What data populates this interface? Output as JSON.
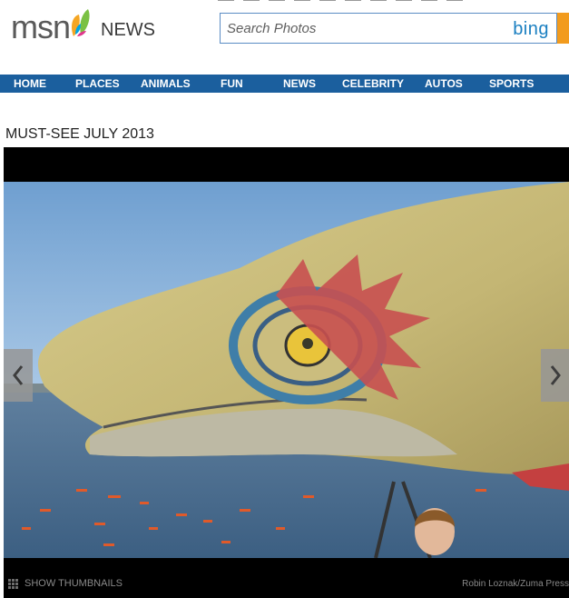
{
  "header": {
    "logo_text": "msn",
    "section_label": "NEWS",
    "search": {
      "placeholder": "Search Photos",
      "engine": "bing"
    }
  },
  "nav": {
    "items": [
      {
        "label": "HOME"
      },
      {
        "label": "PLACES"
      },
      {
        "label": "ANIMALS"
      },
      {
        "label": "FUN"
      },
      {
        "label": "NEWS"
      },
      {
        "label": "CELEBRITY"
      },
      {
        "label": "AUTOS"
      },
      {
        "label": "SPORTS"
      }
    ]
  },
  "gallery": {
    "title": "MUST-SEE JULY 2013",
    "show_thumbnails_label": "SHOW THUMBNAILS",
    "credit": "Robin Loznak/Zuma Press",
    "prev_icon": "chevron-left-icon",
    "next_icon": "chevron-right-icon"
  },
  "colors": {
    "nav_bg": "#1b5f9e",
    "bing_blue": "#1a7fc1",
    "search_accent": "#f29b1d",
    "frame_bg": "#000000"
  }
}
